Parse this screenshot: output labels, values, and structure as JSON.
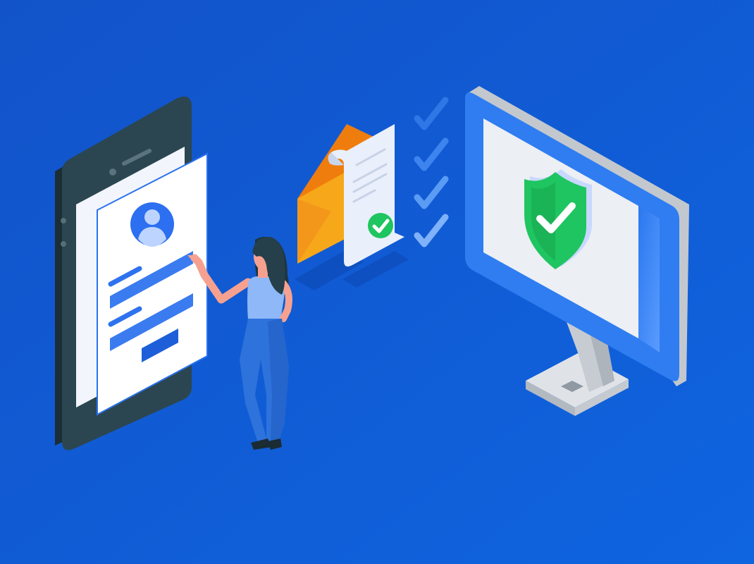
{
  "colors": {
    "background_start": "#1253c9",
    "background_end": "#0f64e0",
    "phone_body": "#26404a",
    "form_accent": "#2f72ee",
    "envelope": "#f6a312",
    "check_green": "#1fc560",
    "monitor_frame": "#2f7df1",
    "stand_gray": "#c7ccd2"
  },
  "icons": {
    "avatar": "user-avatar-icon",
    "document_check": "check-circle-icon",
    "shield_check": "shield-check-icon",
    "checklist": "checkmark-icon"
  }
}
